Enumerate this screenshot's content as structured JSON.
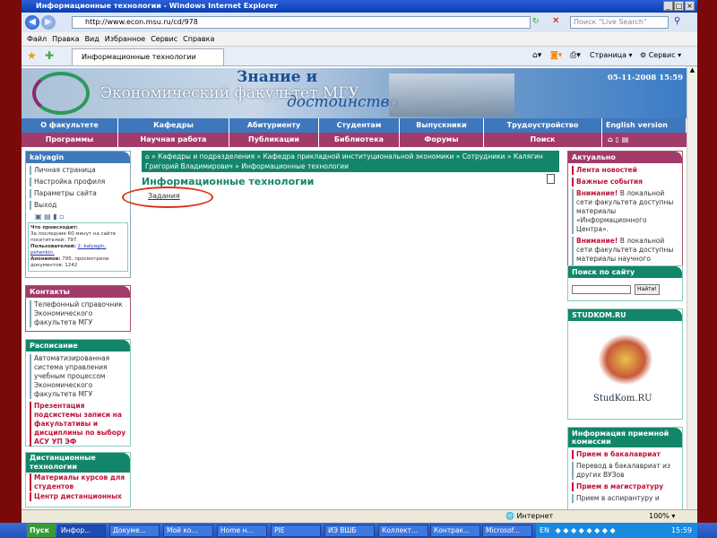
{
  "window": {
    "title": "Информационные технологии - Windows Internet Explorer",
    "url": "http://www.econ.msu.ru/cd/978",
    "search_placeholder": "Поиск \"Live Search\"",
    "tab_title": "Информационные технологии",
    "page_menu": "Страница",
    "tools_menu": "Сервис"
  },
  "menu": [
    "Файл",
    "Правка",
    "Вид",
    "Избранное",
    "Сервис",
    "Справка"
  ],
  "banner": {
    "title": "Экономический факультет МГУ",
    "slogan1": "Знание и",
    "slogan2": "достоинство",
    "datetime": "05-11-2008 15:59"
  },
  "nav1": [
    "О факультете",
    "Кафедры",
    "Абитуриенту",
    "Студентам",
    "Выпускники",
    "Трудоустройство",
    "English version"
  ],
  "nav2": [
    "Программы",
    "Научная работа",
    "Публикации",
    "Библиотека",
    "Форумы",
    "Поиск"
  ],
  "user": {
    "name": "kalyagin",
    "links": [
      "Личная страница",
      "Настройка профиля",
      "Параметры сайта",
      "Выход"
    ],
    "stats_title": "Что происходит:",
    "stats_text": "За последние 60 минут на сайте посетителей: 797.",
    "users_label": "Пользователей:",
    "users_text": "2. kalyagin, pshenkin.",
    "anon_label": "Анонимов:",
    "anon_text": "795, просмотрели документов: 1242"
  },
  "contacts": {
    "title": "Контакты",
    "items": [
      "Телефонный справочник Экономического факультета МГУ"
    ]
  },
  "schedule": {
    "title": "Расписание",
    "item": "Автоматизированная система управления учебным процессом Экономического факультета МГУ",
    "red": "Презентация подсистемы записи на факультативы и дисциплины по выбору АСУ УП ЭФ"
  },
  "distance": {
    "title": "Дистанционные технологии",
    "items": [
      "Материалы курсов для студентов",
      "Центр дистанционных"
    ]
  },
  "breadcrumb": [
    "Кафедры и подразделения",
    "Кафедра прикладной институциональной экономики",
    "Сотрудники",
    "Калягин Григорий Владимирович",
    "Информационные технологии"
  ],
  "main": {
    "title": "Информационные технологии",
    "link": "Задания"
  },
  "actual": {
    "title": "Актуально",
    "links": [
      "Лента новостей",
      "Важные события"
    ],
    "warn": "Внимание!",
    "notes": [
      "В локальной сети факультета доступны материалы «Информационного Центра».",
      "В локальной сети факультета доступны материалы научного отдела."
    ]
  },
  "site_search": {
    "title": "Поиск по сайту",
    "button": "Найти!"
  },
  "studkom": {
    "title": "STUDKOM.RU",
    "logo": "StudKom.RU"
  },
  "admission": {
    "title": "Информация приемной комиссии",
    "items": [
      "Прием в бакалавриат",
      "Перевод в бакалавриат из других ВУЗов",
      "Прием в магистратуру",
      "Прием в аспирантуру и"
    ]
  },
  "status": {
    "zone": "Интернет",
    "zoom": "100%"
  },
  "taskbar": {
    "start": "Пуск",
    "tasks": [
      "Инфор...",
      "Докуме...",
      "Мой ко...",
      "Home н...",
      "PIE",
      "ИЭ ВШБ",
      "Коллект...",
      "Контрак...",
      "Microsof..."
    ],
    "clock": "15:59",
    "lang": "EN"
  }
}
